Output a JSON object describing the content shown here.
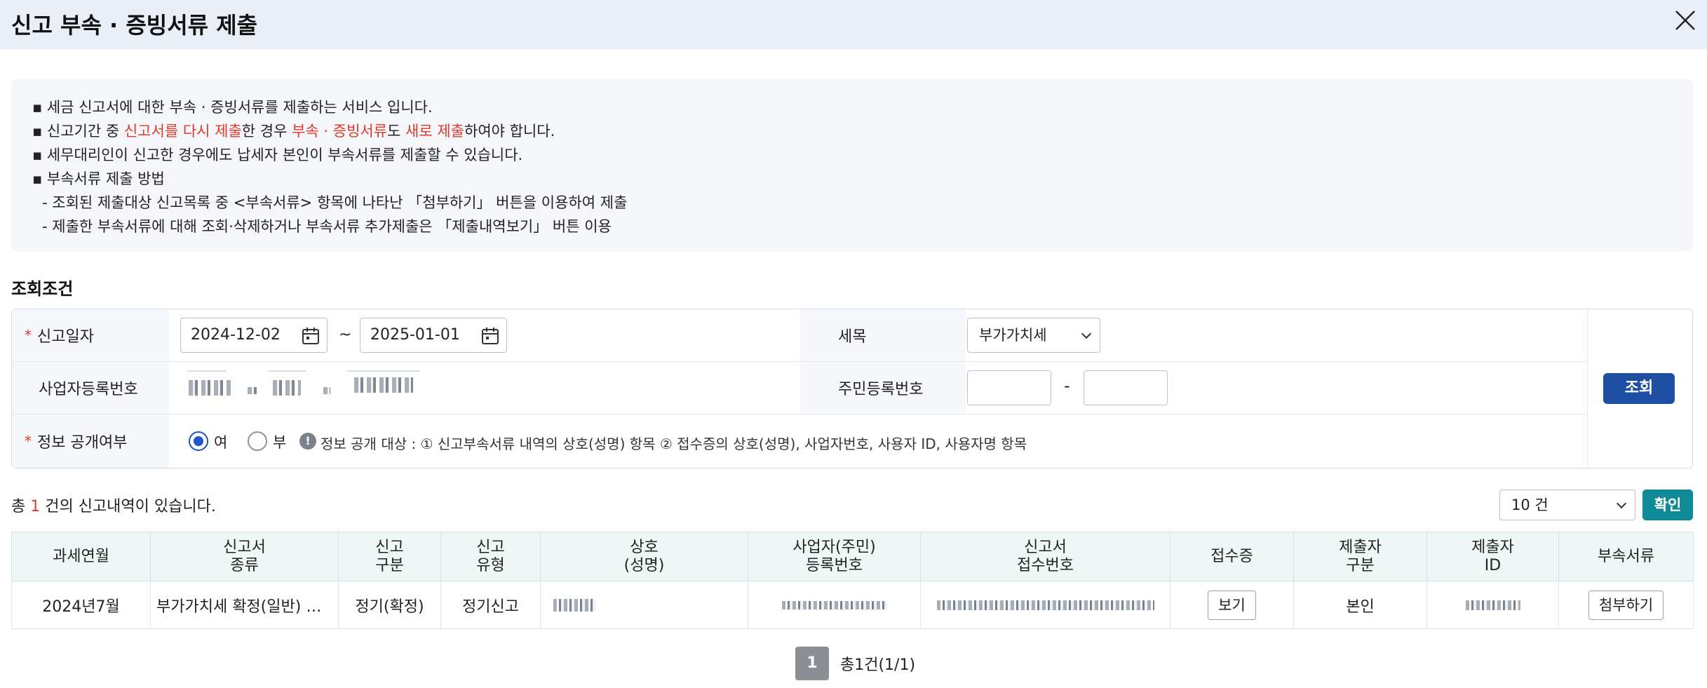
{
  "header": {
    "title": "신고 부속 · 증빙서류 제출"
  },
  "notice": {
    "line1": "▪ 세금 신고서에 대한 부속 · 증빙서류를 제출하는 서비스 입니다.",
    "line2": {
      "a": "▪ 신고기간 중 ",
      "b": "신고서를 다시 제출",
      "c": "한 경우 ",
      "d": "부속 · 증빙서류",
      "e": "도 ",
      "f": "새로 제출",
      "g": "하여야 합니다."
    },
    "line3": "▪ 세무대리인이 신고한 경우에도 납세자 본인이 부속서류를 제출할 수 있습니다.",
    "line4": "▪ 부속서류 제출 방법",
    "line5": "- 조회된 제출대상 신고목록 중 <부속서류> 항목에 나타난 「첨부하기」 버튼을 이용하여 제출",
    "line6": "- 제출한 부속서류에 대해 조회·삭제하거나 부속서류 추가제출은 「제출내역보기」 버튼 이용"
  },
  "search": {
    "section_title": "조회조건",
    "date_label": "신고일자",
    "date_from": "2024-12-02",
    "date_to": "2025-01-01",
    "date_sep": "~",
    "tax_label": "세목",
    "tax_value": "부가가치세",
    "bizno_label": "사업자등록번호",
    "resno_label": "주민등록번호",
    "resno_sep": "-",
    "disclose_label": "정보 공개여부",
    "opt_yes": "여",
    "opt_no": "부",
    "disclose_selected": "여",
    "info_icon": "!",
    "info_text": "정보 공개 대상 : ① 신고부속서류 내역의 상호(성명) 항목 ② 접수증의 상호(성명), 사업자번호, 사용자 ID, 사용자명 항목",
    "search_button": "조회"
  },
  "results": {
    "total_prefix": "총 ",
    "total_count": "1",
    "total_suffix": " 건의 신고내역이 있습니다.",
    "page_size": "10 건",
    "confirm_button": "확인",
    "columns": {
      "c1": "과세연월",
      "c2a": "신고서",
      "c2b": "종류",
      "c3a": "신고",
      "c3b": "구분",
      "c4a": "신고",
      "c4b": "유형",
      "c5a": "상호",
      "c5b": "(성명)",
      "c6a": "사업자(주민)",
      "c6b": "등록번호",
      "c7a": "신고서",
      "c7b": "접수번호",
      "c8": "접수증",
      "c9a": "제출자",
      "c9b": "구분",
      "c10a": "제출자",
      "c10b": "ID",
      "c11": "부속서류"
    },
    "row": {
      "period": "2024년7월",
      "form_type": "부가가치세 확정(일반) …",
      "report_class": "정기(확정)",
      "report_type": "정기신고",
      "view_button": "보기",
      "submitter_type": "본인",
      "attach_button": "첨부하기"
    }
  },
  "pager": {
    "current": "1",
    "summary": "총1건(1/1)"
  },
  "colors": {
    "header_bg": "#e9eef7",
    "accent_red": "#e0392a",
    "search_button": "#1f4fa3",
    "confirm_button": "#0f8a96",
    "radio_on": "#1e55c8"
  }
}
